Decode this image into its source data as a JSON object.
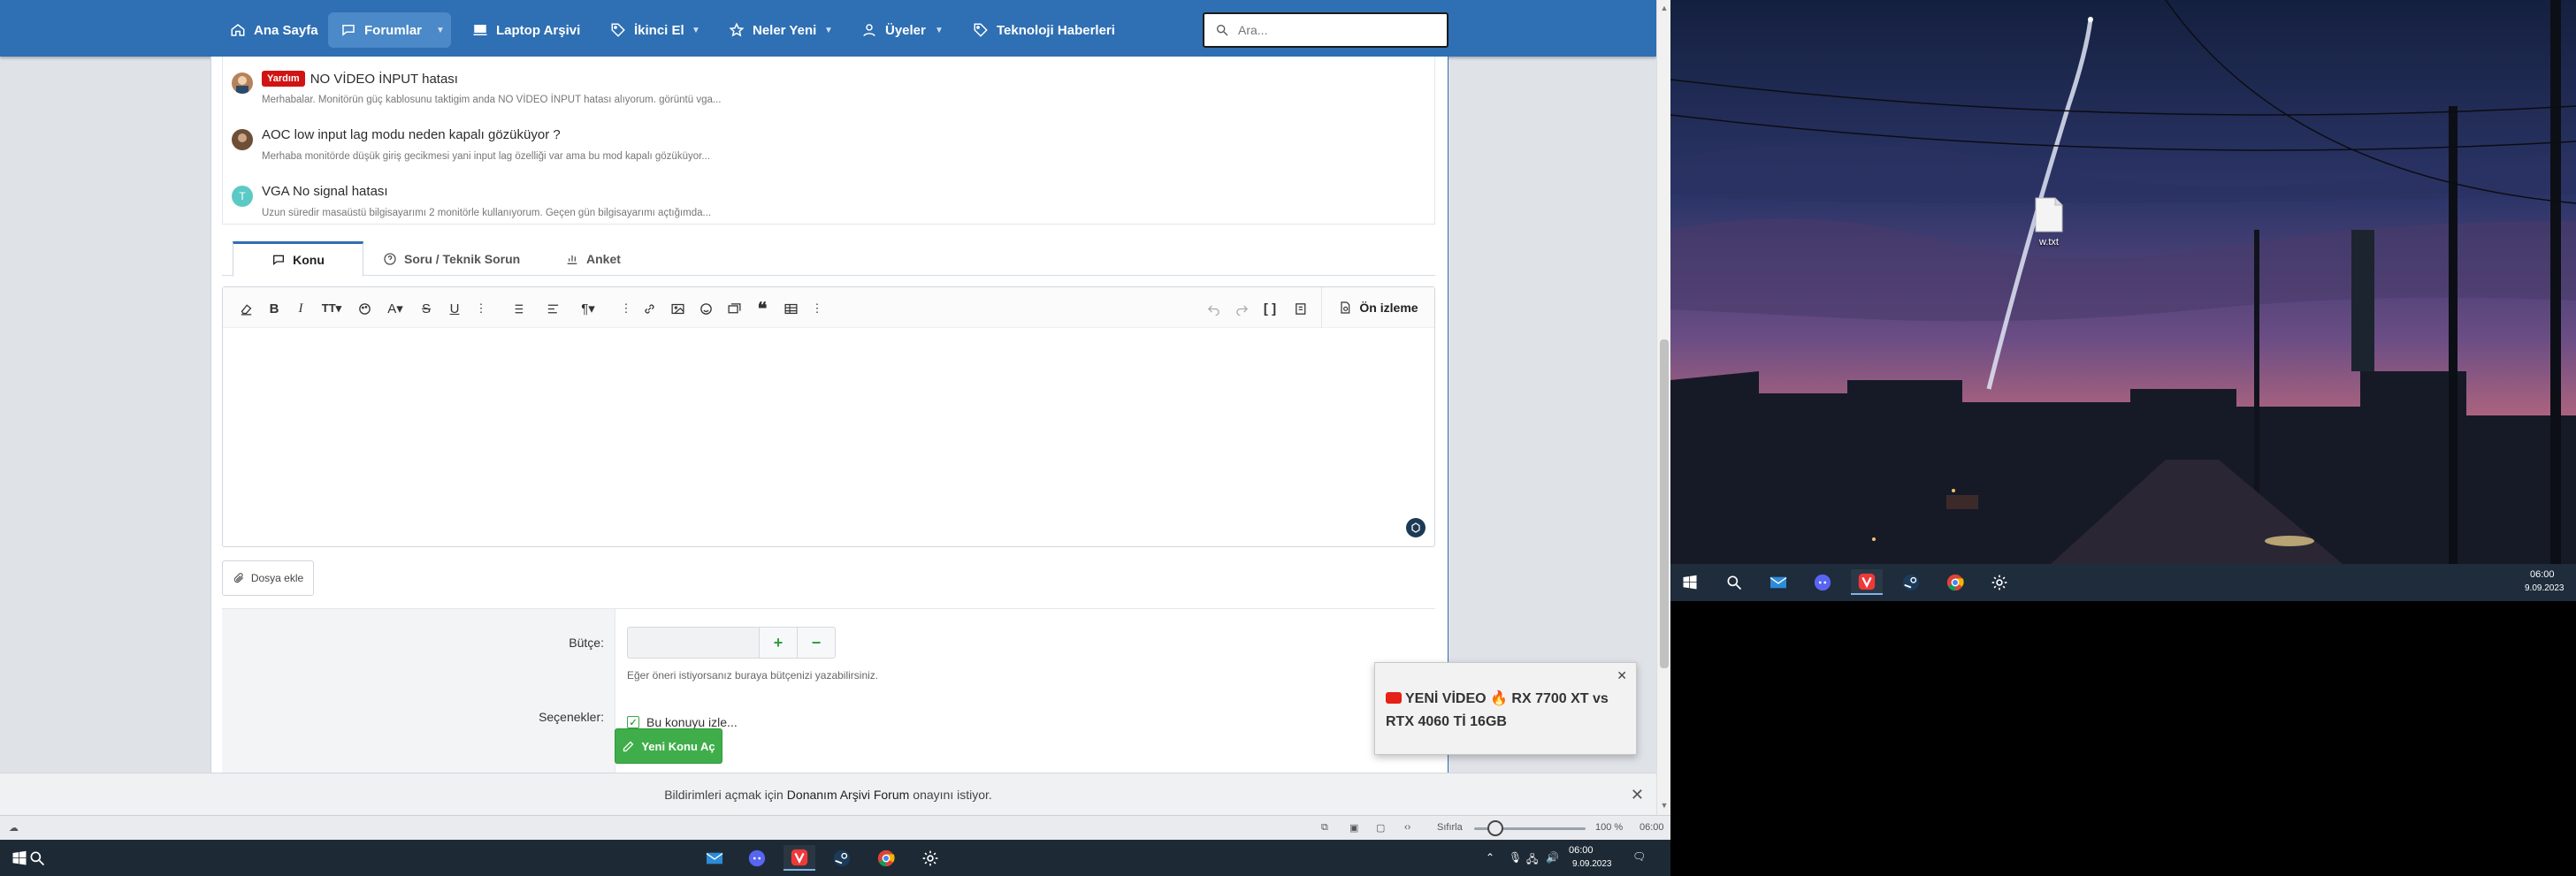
{
  "nav": {
    "items": [
      {
        "label": "Ana Sayfa",
        "icon": "home-icon"
      },
      {
        "label": "Forumlar",
        "icon": "chat-icon"
      },
      {
        "label": "Laptop Arşivi",
        "icon": "laptop-icon"
      },
      {
        "label": "İkinci El",
        "icon": "tag-icon"
      },
      {
        "label": "Neler Yeni",
        "icon": "star-icon"
      },
      {
        "label": "Üyeler",
        "icon": "user-icon"
      },
      {
        "label": "Teknoloji Haberleri",
        "icon": "tag-icon"
      }
    ],
    "search_placeholder": "Ara..."
  },
  "similar_threads": [
    {
      "prefix": "Yardım",
      "title": "NO VİDEO İNPUT hatası",
      "snippet": "Merhabalar. Monitörün güç kablosunu taktigim anda NO VİDEO İNPUT hatası alıyorum. görüntü vga..."
    },
    {
      "prefix": "",
      "title": "AOC low input lag modu neden kapalı gözüküyor ?",
      "snippet": "Merhaba monitörde düşük giriş gecikmesi yani input lag özelliği var ama bu mod kapalı gözüküyor..."
    },
    {
      "prefix": "",
      "title": "VGA No signal hatası",
      "avatar_letter": "T",
      "snippet": "Uzun süredir masaüstü bilgisayarımı 2 monitörle kullanıyorum. Geçen gün bilgisayarımı açtığımda..."
    }
  ],
  "tabs": [
    {
      "label": "Konu"
    },
    {
      "label": "Soru / Teknik Sorun"
    },
    {
      "label": "Anket"
    }
  ],
  "editor": {
    "preview_label": "Ön izleme",
    "attach_label": "Dosya ekle"
  },
  "form": {
    "budget_label": "Bütçe:",
    "budget_value": "",
    "budget_plus": "+",
    "budget_minus": "−",
    "budget_hint": "Eğer öneri istiyorsanız buraya bütçenizi yazabilirsiniz.",
    "options_label": "Seçenekler:",
    "follow_label": "Bu konuyu izle...",
    "follow_checked": true,
    "submit_label": "Yeni Konu Aç"
  },
  "notification": {
    "text_before": "Bildirimleri açmak için ",
    "site": "Donanım Arşivi Forum",
    "text_after": " onayını istiyor."
  },
  "statusbar": {
    "page_label": "Sıfırla",
    "zoom": "100 %",
    "zoom_fraction": 0.12,
    "time": "06:00"
  },
  "taskbar_left": {
    "time": "06:00",
    "date": "9.09.2023"
  },
  "popup": {
    "text": "YENİ VİDEO 🔥 RX 7700 XT vs RTX 4060 Tİ 16GB"
  },
  "desktop": {
    "file_name": "w.txt"
  },
  "taskbar_right": {
    "time": "06:00",
    "date": "9.09.2023"
  },
  "colors": {
    "nav": "#2f6fb3",
    "accent_green": "#3fae4a",
    "badge_red": "#d01414"
  }
}
